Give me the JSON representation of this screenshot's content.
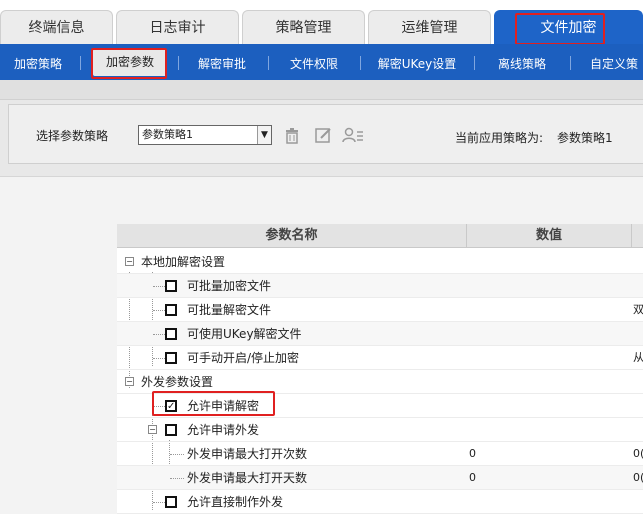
{
  "top_tabs": [
    {
      "label": "终端信息"
    },
    {
      "label": "日志审计"
    },
    {
      "label": "策略管理"
    },
    {
      "label": "运维管理"
    },
    {
      "label": "文件加密",
      "active": true
    }
  ],
  "sub_nav": [
    {
      "label": "加密策略"
    },
    {
      "label": "加密参数",
      "active": true
    },
    {
      "label": "解密审批"
    },
    {
      "label": "文件权限"
    },
    {
      "label": "解密UKey设置"
    },
    {
      "label": "离线策略"
    },
    {
      "label": "自定义策"
    }
  ],
  "toolbar": {
    "select_label": "选择参数策略",
    "select_value": "参数策略1",
    "current_label": "当前应用策略为:",
    "current_value": "参数策略1",
    "icons": [
      "trash-icon",
      "edit-icon",
      "user-list-icon"
    ]
  },
  "grid": {
    "headers": {
      "name": "参数名称",
      "value": "数值"
    },
    "rows": [
      {
        "type": "group",
        "label": "本地加解密设置",
        "expander": "−"
      },
      {
        "type": "item",
        "label": "可批量加密文件",
        "checked": false,
        "value": "",
        "extra": ""
      },
      {
        "type": "item",
        "label": "可批量解密文件",
        "checked": false,
        "value": "",
        "extra": "双"
      },
      {
        "type": "item",
        "label": "可使用UKey解密文件",
        "checked": false,
        "value": "",
        "extra": ""
      },
      {
        "type": "item",
        "label": "可手动开启/停止加密",
        "checked": false,
        "value": "",
        "extra": "从"
      },
      {
        "type": "group",
        "label": "外发参数设置",
        "expander": "−"
      },
      {
        "type": "item",
        "label": "允许申请解密",
        "checked": true,
        "value": "",
        "extra": ""
      },
      {
        "type": "subgroup",
        "label": "允许申请外发",
        "checked": false,
        "expander": "−"
      },
      {
        "type": "leaf",
        "label": "外发申请最大打开次数",
        "value": "0",
        "extra": "0("
      },
      {
        "type": "leaf",
        "label": "外发申请最大打开天数",
        "value": "0",
        "extra": "0("
      },
      {
        "type": "item",
        "label": "允许直接制作外发",
        "checked": false,
        "value": "",
        "extra": ""
      }
    ]
  },
  "colors": {
    "accent": "#1e64c8",
    "highlight": "#e02020"
  }
}
